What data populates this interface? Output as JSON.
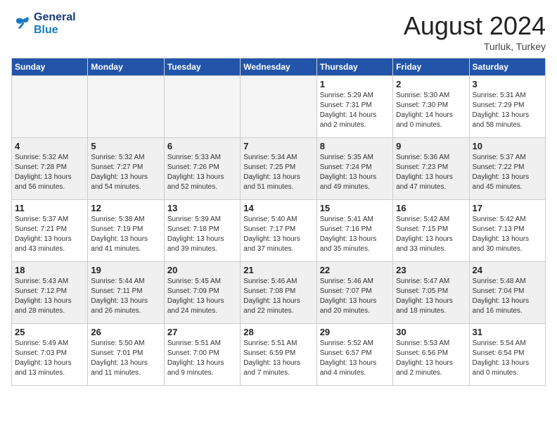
{
  "header": {
    "logo_line1": "General",
    "logo_line2": "Blue",
    "month": "August 2024",
    "location": "Turluk, Turkey"
  },
  "weekdays": [
    "Sunday",
    "Monday",
    "Tuesday",
    "Wednesday",
    "Thursday",
    "Friday",
    "Saturday"
  ],
  "weeks": [
    [
      {
        "day": "",
        "info": ""
      },
      {
        "day": "",
        "info": ""
      },
      {
        "day": "",
        "info": ""
      },
      {
        "day": "",
        "info": ""
      },
      {
        "day": "1",
        "info": "Sunrise: 5:29 AM\nSunset: 7:31 PM\nDaylight: 14 hours\nand 2 minutes."
      },
      {
        "day": "2",
        "info": "Sunrise: 5:30 AM\nSunset: 7:30 PM\nDaylight: 14 hours\nand 0 minutes."
      },
      {
        "day": "3",
        "info": "Sunrise: 5:31 AM\nSunset: 7:29 PM\nDaylight: 13 hours\nand 58 minutes."
      }
    ],
    [
      {
        "day": "4",
        "info": "Sunrise: 5:32 AM\nSunset: 7:28 PM\nDaylight: 13 hours\nand 56 minutes."
      },
      {
        "day": "5",
        "info": "Sunrise: 5:32 AM\nSunset: 7:27 PM\nDaylight: 13 hours\nand 54 minutes."
      },
      {
        "day": "6",
        "info": "Sunrise: 5:33 AM\nSunset: 7:26 PM\nDaylight: 13 hours\nand 52 minutes."
      },
      {
        "day": "7",
        "info": "Sunrise: 5:34 AM\nSunset: 7:25 PM\nDaylight: 13 hours\nand 51 minutes."
      },
      {
        "day": "8",
        "info": "Sunrise: 5:35 AM\nSunset: 7:24 PM\nDaylight: 13 hours\nand 49 minutes."
      },
      {
        "day": "9",
        "info": "Sunrise: 5:36 AM\nSunset: 7:23 PM\nDaylight: 13 hours\nand 47 minutes."
      },
      {
        "day": "10",
        "info": "Sunrise: 5:37 AM\nSunset: 7:22 PM\nDaylight: 13 hours\nand 45 minutes."
      }
    ],
    [
      {
        "day": "11",
        "info": "Sunrise: 5:37 AM\nSunset: 7:21 PM\nDaylight: 13 hours\nand 43 minutes."
      },
      {
        "day": "12",
        "info": "Sunrise: 5:38 AM\nSunset: 7:19 PM\nDaylight: 13 hours\nand 41 minutes."
      },
      {
        "day": "13",
        "info": "Sunrise: 5:39 AM\nSunset: 7:18 PM\nDaylight: 13 hours\nand 39 minutes."
      },
      {
        "day": "14",
        "info": "Sunrise: 5:40 AM\nSunset: 7:17 PM\nDaylight: 13 hours\nand 37 minutes."
      },
      {
        "day": "15",
        "info": "Sunrise: 5:41 AM\nSunset: 7:16 PM\nDaylight: 13 hours\nand 35 minutes."
      },
      {
        "day": "16",
        "info": "Sunrise: 5:42 AM\nSunset: 7:15 PM\nDaylight: 13 hours\nand 33 minutes."
      },
      {
        "day": "17",
        "info": "Sunrise: 5:42 AM\nSunset: 7:13 PM\nDaylight: 13 hours\nand 30 minutes."
      }
    ],
    [
      {
        "day": "18",
        "info": "Sunrise: 5:43 AM\nSunset: 7:12 PM\nDaylight: 13 hours\nand 28 minutes."
      },
      {
        "day": "19",
        "info": "Sunrise: 5:44 AM\nSunset: 7:11 PM\nDaylight: 13 hours\nand 26 minutes."
      },
      {
        "day": "20",
        "info": "Sunrise: 5:45 AM\nSunset: 7:09 PM\nDaylight: 13 hours\nand 24 minutes."
      },
      {
        "day": "21",
        "info": "Sunrise: 5:46 AM\nSunset: 7:08 PM\nDaylight: 13 hours\nand 22 minutes."
      },
      {
        "day": "22",
        "info": "Sunrise: 5:46 AM\nSunset: 7:07 PM\nDaylight: 13 hours\nand 20 minutes."
      },
      {
        "day": "23",
        "info": "Sunrise: 5:47 AM\nSunset: 7:05 PM\nDaylight: 13 hours\nand 18 minutes."
      },
      {
        "day": "24",
        "info": "Sunrise: 5:48 AM\nSunset: 7:04 PM\nDaylight: 13 hours\nand 16 minutes."
      }
    ],
    [
      {
        "day": "25",
        "info": "Sunrise: 5:49 AM\nSunset: 7:03 PM\nDaylight: 13 hours\nand 13 minutes."
      },
      {
        "day": "26",
        "info": "Sunrise: 5:50 AM\nSunset: 7:01 PM\nDaylight: 13 hours\nand 11 minutes."
      },
      {
        "day": "27",
        "info": "Sunrise: 5:51 AM\nSunset: 7:00 PM\nDaylight: 13 hours\nand 9 minutes."
      },
      {
        "day": "28",
        "info": "Sunrise: 5:51 AM\nSunset: 6:59 PM\nDaylight: 13 hours\nand 7 minutes."
      },
      {
        "day": "29",
        "info": "Sunrise: 5:52 AM\nSunset: 6:57 PM\nDaylight: 13 hours\nand 4 minutes."
      },
      {
        "day": "30",
        "info": "Sunrise: 5:53 AM\nSunset: 6:56 PM\nDaylight: 13 hours\nand 2 minutes."
      },
      {
        "day": "31",
        "info": "Sunrise: 5:54 AM\nSunset: 6:54 PM\nDaylight: 13 hours\nand 0 minutes."
      }
    ]
  ]
}
